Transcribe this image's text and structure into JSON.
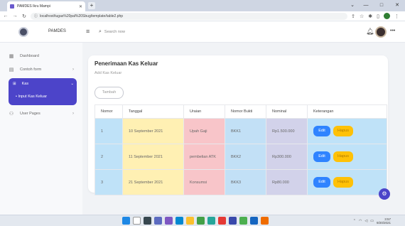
{
  "browser": {
    "tab_title": "PAMDES Ikru Mampi",
    "new_tab": "+",
    "url": "localhost/tugas%20pal%20Sbug/template/table2.php",
    "window_controls": [
      "⌄",
      "—",
      "□",
      "✕"
    ]
  },
  "header": {
    "brand": "PAMDES",
    "search_placeholder": "Search now"
  },
  "sidebar": {
    "items": [
      {
        "label": "Dashboard",
        "icon": "grid-icon"
      },
      {
        "label": "Contoh form",
        "icon": "form-icon"
      },
      {
        "label": "Kas",
        "icon": "table-icon"
      },
      {
        "label": "User Pages",
        "icon": "user-icon"
      }
    ],
    "active_sub": "• Input Kas Keluar"
  },
  "card": {
    "title": "Penerimaan Kas Keluar",
    "subtitle": "Add Kas Keluar",
    "add_button": "Tambah"
  },
  "table": {
    "headers": [
      "Nomor",
      "Tanggal",
      "Uraian",
      "Nomor Bukti",
      "Nominal",
      "Keterangan"
    ],
    "rows": [
      {
        "nomor": "1",
        "tanggal": "10 September 2021",
        "uraian": "Upah Gaji",
        "bukti": "BKK1",
        "nominal": "Rp1.500.000"
      },
      {
        "nomor": "2",
        "tanggal": "11 September 2021",
        "uraian": "pembelian ATK",
        "bukti": "BKK2",
        "nominal": "Rp300.000"
      },
      {
        "nomor": "3",
        "tanggal": "21 September 2021",
        "uraian": "Konsumsi",
        "bukti": "BKK3",
        "nominal": "Rp80.000"
      }
    ],
    "edit_label": "Edit",
    "delete_label": "Hapus"
  },
  "taskbar": {
    "time": "3:57",
    "date": "9/20/2021"
  },
  "colors": {
    "accent": "#4c44c9",
    "edit": "#2f83ff",
    "delete": "#ffc107"
  }
}
